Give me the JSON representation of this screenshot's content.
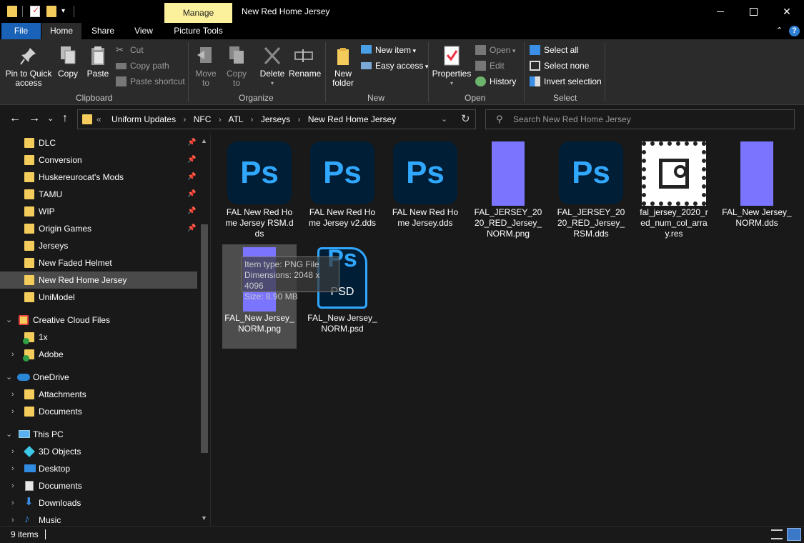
{
  "titlebar": {
    "manage_label": "Manage",
    "window_title": "New Red Home Jersey"
  },
  "ribbon_tabs": {
    "file": "File",
    "home": "Home",
    "share": "Share",
    "view": "View",
    "picture_tools": "Picture Tools"
  },
  "ribbon": {
    "clipboard": {
      "group_label": "Clipboard",
      "pin": "Pin to Quick access",
      "copy": "Copy",
      "paste": "Paste",
      "cut": "Cut",
      "copy_path": "Copy path",
      "paste_shortcut": "Paste shortcut"
    },
    "organize": {
      "group_label": "Organize",
      "move_to": "Move to",
      "copy_to": "Copy to",
      "delete": "Delete",
      "rename": "Rename"
    },
    "new": {
      "group_label": "New",
      "new_folder": "New folder",
      "new_item": "New item",
      "easy_access": "Easy access"
    },
    "open": {
      "group_label": "Open",
      "properties": "Properties",
      "open": "Open",
      "edit": "Edit",
      "history": "History"
    },
    "select": {
      "group_label": "Select",
      "select_all": "Select all",
      "select_none": "Select none",
      "invert_selection": "Invert selection"
    }
  },
  "address": {
    "overflow": "«",
    "crumbs": [
      "Uniform Updates",
      "NFC",
      "ATL",
      "Jerseys",
      "New Red Home Jersey"
    ]
  },
  "search": {
    "placeholder": "Search New Red Home Jersey"
  },
  "nav": {
    "items": [
      {
        "label": "DLC",
        "pinned": true
      },
      {
        "label": "Conversion",
        "pinned": true
      },
      {
        "label": "Huskereurocat's Mods",
        "pinned": true
      },
      {
        "label": "TAMU",
        "pinned": true
      },
      {
        "label": "WIP",
        "pinned": true
      },
      {
        "label": "Origin Games",
        "pinned": true
      },
      {
        "label": "Jerseys",
        "pinned": false
      },
      {
        "label": "New Faded Helmet",
        "pinned": false
      },
      {
        "label": "New Red Home Jersey",
        "pinned": false,
        "selected": true
      },
      {
        "label": "UniModel",
        "pinned": false
      },
      {
        "label": "Creative Cloud Files"
      },
      {
        "label": "1x"
      },
      {
        "label": "Adobe"
      },
      {
        "label": "OneDrive"
      },
      {
        "label": "Attachments"
      },
      {
        "label": "Documents"
      },
      {
        "label": "This PC"
      },
      {
        "label": "3D Objects"
      },
      {
        "label": "Desktop"
      },
      {
        "label": "Documents"
      },
      {
        "label": "Downloads"
      },
      {
        "label": "Music"
      }
    ]
  },
  "files": [
    {
      "name": "FAL New Red Home Jersey RSM.dds",
      "icon": "photoshop-icon"
    },
    {
      "name": "FAL New Red Home Jersey v2.dds",
      "icon": "photoshop-icon"
    },
    {
      "name": "FAL New Red Home Jersey.dds",
      "icon": "photoshop-icon"
    },
    {
      "name": "FAL_JERSEY_2020_RED_Jersey_NORM.png",
      "icon": "purple-thumbnail"
    },
    {
      "name": "FAL_JERSEY_2020_RED_Jersey_RSM.dds",
      "icon": "photoshop-icon"
    },
    {
      "name": "fal_jersey_2020_red_num_col_array.res",
      "icon": "image-file-icon"
    },
    {
      "name": "FAL_New Jersey_NORM.dds",
      "icon": "purple-thumbnail"
    },
    {
      "name": "FAL_New Jersey_NORM.png",
      "icon": "purple-thumbnail",
      "selected": true
    },
    {
      "name": "FAL_New Jersey_NORM.psd",
      "icon": "psd-icon"
    }
  ],
  "tooltip": {
    "type": "Item type: PNG File",
    "dimensions": "Dimensions: 2048 x 4096",
    "size": "Size: 8.90 MB"
  },
  "status": {
    "items_count": "9 items"
  },
  "icons": {
    "ps": "Ps",
    "psd": "PSD"
  },
  "colors": {
    "accent": "#1a62b8",
    "manage_tab": "#fbf19c",
    "folder": "#f3cc5c",
    "photoshop_blue": "#31a8ff",
    "photoshop_bg": "#001e36",
    "normal_map_purple": "#7a74ff"
  }
}
